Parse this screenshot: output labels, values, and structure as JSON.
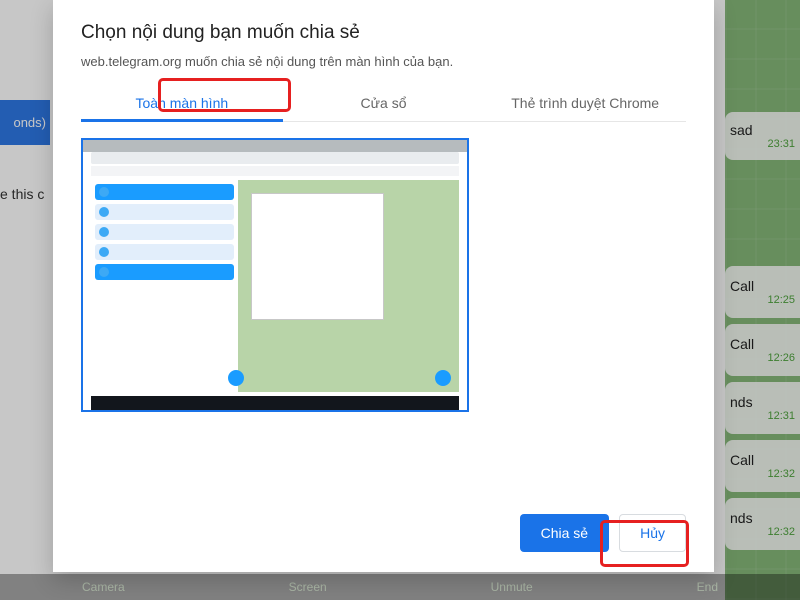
{
  "background": {
    "left_pill": "onds)",
    "left_text_fragment": "e this c",
    "top_bubble": {
      "name": "sad",
      "time": "23:31"
    },
    "bubbles": [
      {
        "title": "Call",
        "time": "12:25"
      },
      {
        "title": "Call",
        "time": "12:26"
      },
      {
        "title": "nds",
        "time": "12:31"
      },
      {
        "title": "Call",
        "time": "12:32"
      },
      {
        "title": "nds",
        "time": "12:32"
      }
    ],
    "bottom_controls": [
      "Camera",
      "Screen",
      "Unmute",
      "End"
    ]
  },
  "modal": {
    "title": "Chọn nội dung bạn muốn chia sẻ",
    "subtitle": "web.telegram.org muốn chia sẻ nội dung trên màn hình của bạn.",
    "tabs": {
      "fullscreen": "Toàn màn hình",
      "window": "Cửa sổ",
      "chrome_tab": "Thẻ trình duyệt Chrome",
      "active": "fullscreen"
    },
    "buttons": {
      "share": "Chia sẻ",
      "cancel": "Hủy"
    }
  }
}
